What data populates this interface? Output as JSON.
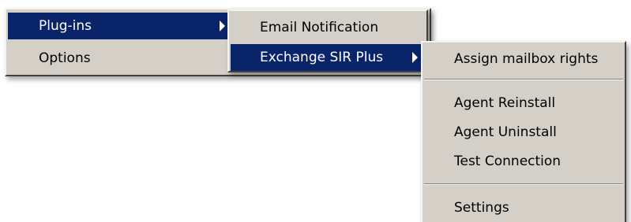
{
  "menu_root": {
    "items": [
      {
        "label": "Plug-ins",
        "selected": true,
        "has_submenu": true
      },
      {
        "label": "Options",
        "selected": false,
        "has_submenu": false
      }
    ]
  },
  "menu_plugins": {
    "items": [
      {
        "label": "Email Notification",
        "selected": false,
        "has_submenu": false
      },
      {
        "label": "Exchange SIR Plus",
        "selected": true,
        "has_submenu": true
      }
    ]
  },
  "menu_exchange": {
    "items": [
      {
        "label": "Assign mailbox rights"
      },
      {
        "label": "Agent Reinstall"
      },
      {
        "label": "Agent Uninstall"
      },
      {
        "label": "Test Connection"
      },
      {
        "label": "Settings"
      }
    ]
  },
  "colors": {
    "menu_background": "#d4d0c8",
    "selection_background": "#0a246a",
    "selection_text": "#ffffff"
  },
  "icons": {
    "submenu_arrow": "chevron-right-icon"
  }
}
